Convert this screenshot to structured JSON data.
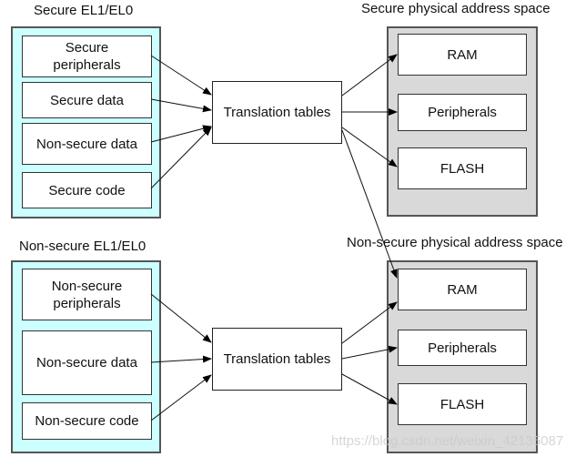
{
  "secure_world": {
    "title": "Secure EL1/EL0",
    "items": [
      "Secure\nperipherals",
      "Secure data",
      "Non-secure data",
      "Secure code"
    ],
    "translation": "Translation tables"
  },
  "secure_physical": {
    "title": "Secure physical address space",
    "items": [
      "RAM",
      "Peripherals",
      "FLASH"
    ]
  },
  "nonsecure_world": {
    "title": "Non-secure EL1/EL0",
    "items": [
      "Non-secure\nperipherals",
      "Non-secure data",
      "Non-secure code"
    ],
    "translation": "Translation tables"
  },
  "nonsecure_physical": {
    "title": "Non-secure physical address space",
    "items": [
      "RAM",
      "Peripherals",
      "FLASH"
    ]
  },
  "colors": {
    "secure_panel": "#ccffff",
    "physical_panel": "#d9d9d9"
  },
  "watermark": "https://blog.csdn.net/weixin_42135087"
}
